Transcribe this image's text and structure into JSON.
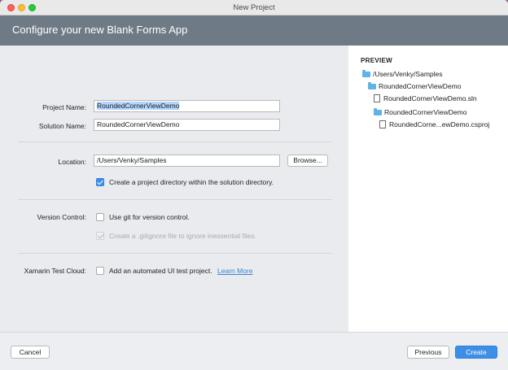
{
  "window": {
    "title": "New Project"
  },
  "header": {
    "heading": "Configure your new Blank Forms App"
  },
  "form": {
    "project_name_label": "Project Name:",
    "project_name_value": "RoundedCornerViewDemo",
    "solution_name_label": "Solution Name:",
    "solution_name_value": "RoundedCornerViewDemo",
    "location_label": "Location:",
    "location_value": "/Users/Venky/Samples",
    "browse_label": "Browse...",
    "create_dir_label": "Create a project directory within the solution directory.",
    "create_dir_checked": true,
    "version_control_label": "Version Control:",
    "use_git_label": "Use git for version control.",
    "use_git_checked": false,
    "gitignore_label": "Create a .gitignore file to ignore inessential files.",
    "gitignore_checked": true,
    "gitignore_enabled": false,
    "test_cloud_label": "Xamarin Test Cloud:",
    "ui_test_label": "Add an automated UI test project.",
    "ui_test_checked": false,
    "learn_more_label": "Learn More"
  },
  "preview": {
    "title": "PREVIEW",
    "tree": [
      {
        "type": "folder",
        "label": "/Users/Venky/Samples"
      },
      {
        "type": "folder",
        "label": "RoundedCornerViewDemo"
      },
      {
        "type": "file",
        "label": "RoundedCornerViewDemo.sln"
      },
      {
        "type": "folder",
        "label": "RoundedCornerViewDemo"
      },
      {
        "type": "file",
        "label": "RoundedCorne...ewDemo.csproj"
      }
    ]
  },
  "footer": {
    "cancel_label": "Cancel",
    "previous_label": "Previous",
    "create_label": "Create"
  },
  "colors": {
    "header_bg": "#6e7b86",
    "accent": "#3d8fe6",
    "folder": "#5fb3e6",
    "link": "#3d83d6"
  }
}
